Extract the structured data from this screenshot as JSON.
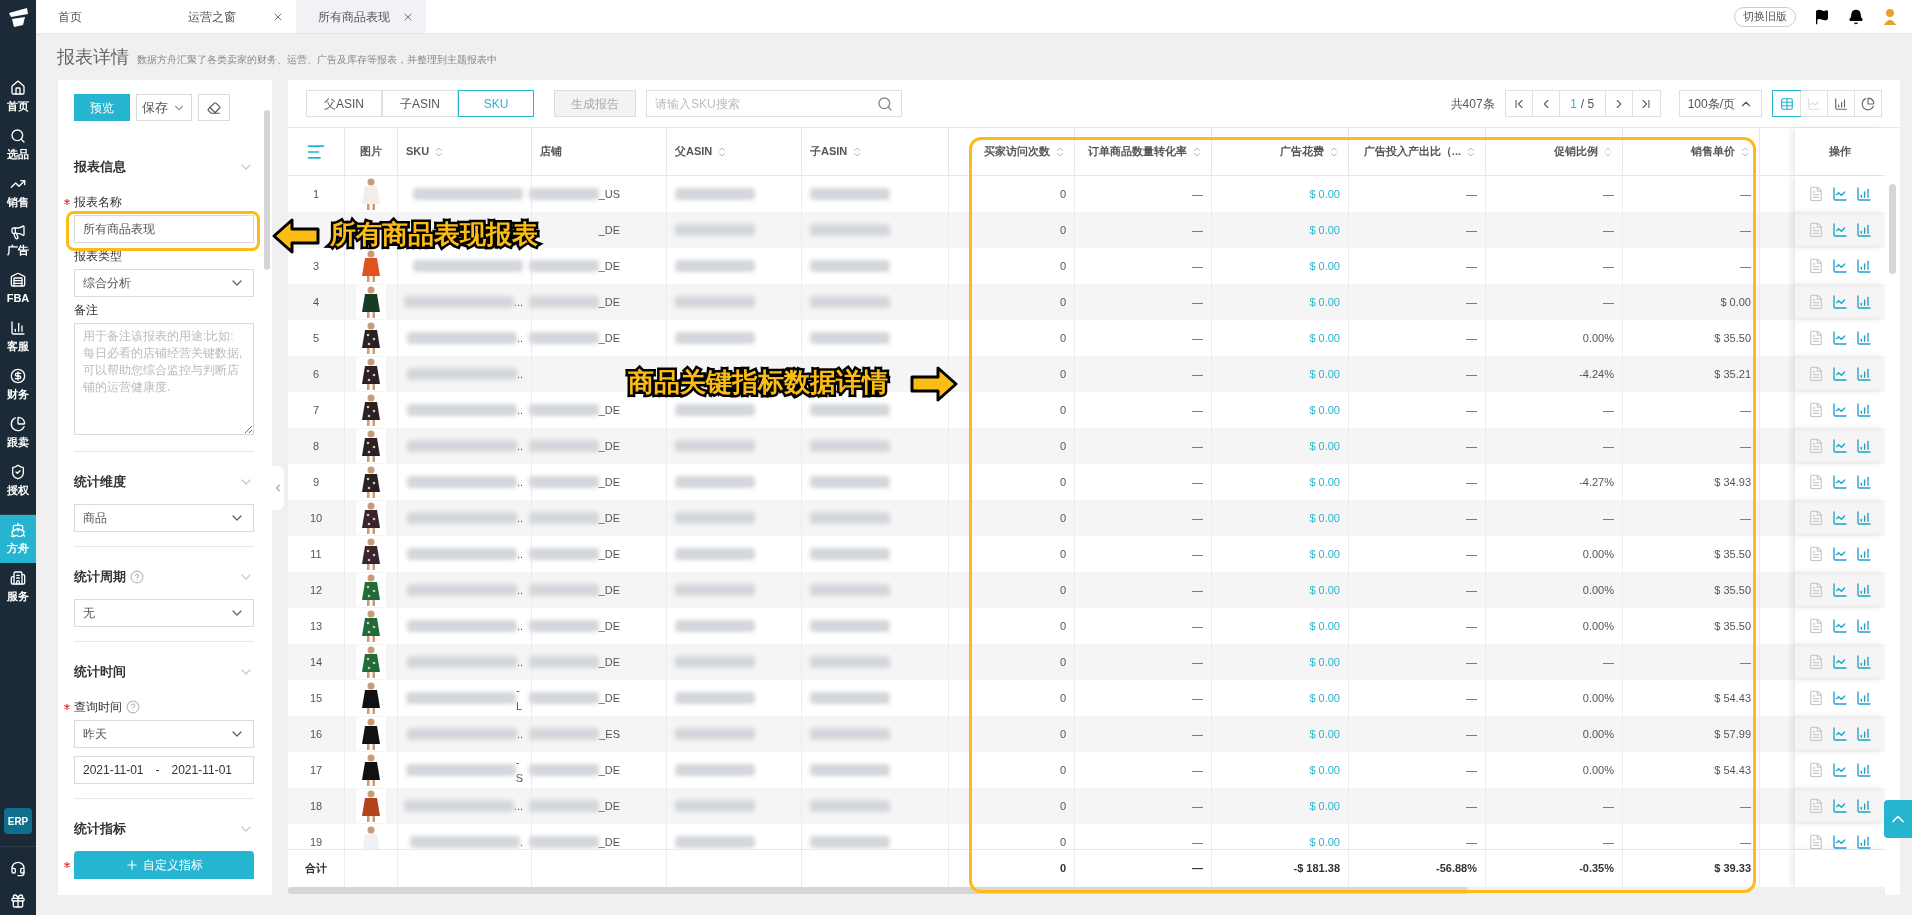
{
  "sidebar": {
    "items": [
      {
        "label": "首页",
        "selected": false
      },
      {
        "label": "选品",
        "selected": false
      },
      {
        "label": "销售",
        "selected": false
      },
      {
        "label": "广告",
        "selected": false
      },
      {
        "label": "FBA",
        "selected": false
      },
      {
        "label": "客服",
        "selected": false
      },
      {
        "label": "财务",
        "selected": false
      },
      {
        "label": "跟卖",
        "selected": false
      },
      {
        "label": "授权",
        "selected": false
      },
      {
        "label": "方舟",
        "selected": true
      },
      {
        "label": "服务",
        "selected": false
      }
    ],
    "badge": "ERP"
  },
  "tabs": [
    {
      "label": "首页",
      "selected": false,
      "closable": false
    },
    {
      "label": "运营之窗",
      "selected": false,
      "closable": true
    },
    {
      "label": "所有商品表现",
      "selected": true,
      "closable": true
    }
  ],
  "header": {
    "switch_button": "切换旧版"
  },
  "page": {
    "title": "报表详情",
    "subtitle": "数据方舟汇聚了各类卖家的财务、运营、广告及库存等报表，并整理到主题报表中"
  },
  "form": {
    "preview_button": "预览",
    "save_button": "保存",
    "sections": [
      {
        "title": "报表信息",
        "help": false,
        "fields": [
          {
            "kind": "input",
            "label": "报表名称",
            "required": true,
            "help": false,
            "value": "所有商品表现"
          },
          {
            "kind": "select",
            "label": "报表类型",
            "required": false,
            "help": false,
            "value": "综合分析"
          },
          {
            "kind": "textarea",
            "label": "备注",
            "required": false,
            "help": false,
            "placeholder": "用于备注该报表的用途:比如:每日必看的店铺经营关键数据,可以帮助您综合监控与判断店铺的运营健康度."
          }
        ]
      },
      {
        "title": "统计维度",
        "help": false,
        "fields": [
          {
            "kind": "select",
            "required": false,
            "help": false,
            "value": "商品"
          }
        ]
      },
      {
        "title": "统计周期",
        "help": true,
        "fields": [
          {
            "kind": "select",
            "required": false,
            "help": false,
            "value": "无"
          }
        ]
      },
      {
        "title": "统计时间",
        "help": false,
        "fields": [
          {
            "kind": "select",
            "label": "查询时间",
            "required": true,
            "help": true,
            "value": "昨天"
          },
          {
            "kind": "daterange",
            "required": false,
            "help": false,
            "start": "2021-11-01",
            "separator": "-",
            "end": "2021-11-01"
          }
        ]
      },
      {
        "title": "统计指标",
        "help": false,
        "fields": [
          {
            "kind": "button",
            "required": true,
            "help": false,
            "label": "自定义指标"
          }
        ]
      }
    ]
  },
  "toolbar": {
    "views": [
      {
        "label": "父ASIN",
        "selected": false
      },
      {
        "label": "子ASIN",
        "selected": false
      },
      {
        "label": "SKU",
        "selected": true
      }
    ],
    "generate_button": {
      "label": "生成报告",
      "disabled": true
    },
    "search": {
      "placeholder": "请输入SKU搜索"
    },
    "total": "共407条",
    "page": "1",
    "pages": "/ 5",
    "page_size": "100条/页",
    "chart_views": [
      {
        "kind": "table",
        "selected": true,
        "disabled": false
      },
      {
        "kind": "line",
        "selected": false,
        "disabled": true
      },
      {
        "kind": "bar",
        "selected": false,
        "disabled": false
      },
      {
        "kind": "pie",
        "selected": false,
        "disabled": false
      }
    ]
  },
  "table": {
    "columns": [
      {
        "label": "图片",
        "sortable": false
      },
      {
        "label": "SKU",
        "sortable": true
      },
      {
        "label": "店铺",
        "sortable": false
      },
      {
        "label": "父ASIN",
        "sortable": true
      },
      {
        "label": "子ASIN",
        "sortable": true
      },
      {
        "label": "买家访问次数",
        "sortable": true
      },
      {
        "label": "订单商品数量转化率",
        "sortable": true
      },
      {
        "label": "广告花费",
        "sortable": true
      },
      {
        "label": "广告投入产出比（...",
        "sortable": true
      },
      {
        "label": "促销比例",
        "sortable": true
      },
      {
        "label": "销售单价",
        "sortable": true
      }
    ],
    "actions_column": "操作",
    "rows": [
      {
        "index": "1",
        "store_tail": "_US",
        "visits": "0",
        "conversion": "—",
        "ad_spend": "$ 0.00",
        "roas": "—",
        "promo": "—",
        "price": "—"
      },
      {
        "store_tail": "_DE",
        "visits": "0",
        "conversion": "—",
        "ad_spend": "$ 0.00",
        "roas": "—",
        "promo": "—",
        "price": "—"
      },
      {
        "index": "3",
        "store_tail": "_DE",
        "visits": "0",
        "conversion": "—",
        "ad_spend": "$ 0.00",
        "roas": "—",
        "promo": "—",
        "price": "—"
      },
      {
        "index": "4",
        "sku_tail": "...",
        "store_tail": "_DE",
        "visits": "0",
        "conversion": "—",
        "ad_spend": "$ 0.00",
        "roas": "—",
        "promo": "—",
        "price": "$ 0.00"
      },
      {
        "index": "5",
        "sku_tail": "..",
        "store_tail": "_DE",
        "visits": "0",
        "conversion": "—",
        "ad_spend": "$ 0.00",
        "roas": "—",
        "promo": "0.00%",
        "price": "$ 35.50"
      },
      {
        "index": "6",
        "sku_tail": "..",
        "visits": "0",
        "conversion": "—",
        "ad_spend": "$ 0.00",
        "roas": "—",
        "promo": "-4.24%",
        "price": "$ 35.21"
      },
      {
        "index": "7",
        "sku_tail": "..",
        "store_tail": "_DE",
        "visits": "0",
        "conversion": "—",
        "ad_spend": "$ 0.00",
        "roas": "—",
        "promo": "—",
        "price": "—"
      },
      {
        "index": "8",
        "sku_tail": "..",
        "store_tail": "_DE",
        "visits": "0",
        "conversion": "—",
        "ad_spend": "$ 0.00",
        "roas": "—",
        "promo": "—",
        "price": "—"
      },
      {
        "index": "9",
        "sku_tail": "..",
        "store_tail": "_DE",
        "visits": "0",
        "conversion": "—",
        "ad_spend": "$ 0.00",
        "roas": "—",
        "promo": "-4.27%",
        "price": "$ 34.93"
      },
      {
        "index": "10",
        "sku_tail": "..",
        "store_tail": "_DE",
        "visits": "0",
        "conversion": "—",
        "ad_spend": "$ 0.00",
        "roas": "—",
        "promo": "—",
        "price": "—"
      },
      {
        "index": "11",
        "sku_tail": "..",
        "store_tail": "_DE",
        "visits": "0",
        "conversion": "—",
        "ad_spend": "$ 0.00",
        "roas": "—",
        "promo": "0.00%",
        "price": "$ 35.50"
      },
      {
        "index": "12",
        "sku_tail": "..",
        "store_tail": "_DE",
        "visits": "0",
        "conversion": "—",
        "ad_spend": "$ 0.00",
        "roas": "—",
        "promo": "0.00%",
        "price": "$ 35.50"
      },
      {
        "index": "13",
        "sku_tail": "..",
        "store_tail": "_DE",
        "visits": "0",
        "conversion": "—",
        "ad_spend": "$ 0.00",
        "roas": "—",
        "promo": "0.00%",
        "price": "$ 35.50"
      },
      {
        "index": "14",
        "sku_tail": "..",
        "store_tail": "_DE",
        "visits": "0",
        "conversion": "—",
        "ad_spend": "$ 0.00",
        "roas": "—",
        "promo": "—",
        "price": "—"
      },
      {
        "index": "15",
        "sku_tail": "-L",
        "store_tail": "_DE",
        "visits": "0",
        "conversion": "—",
        "ad_spend": "$ 0.00",
        "roas": "—",
        "promo": "0.00%",
        "price": "$ 54.43"
      },
      {
        "index": "16",
        "sku_tail": "..",
        "store_tail": "_ES",
        "visits": "0",
        "conversion": "—",
        "ad_spend": "$ 0.00",
        "roas": "—",
        "promo": "0.00%",
        "price": "$ 57.99"
      },
      {
        "index": "17",
        "sku_tail": "-S",
        "store_tail": "_DE",
        "visits": "0",
        "conversion": "—",
        "ad_spend": "$ 0.00",
        "roas": "—",
        "promo": "0.00%",
        "price": "$ 54.43"
      },
      {
        "index": "18",
        "sku_tail": "...",
        "store_tail": "_DE",
        "visits": "0",
        "conversion": "—",
        "ad_spend": "$ 0.00",
        "roas": "—",
        "promo": "—",
        "price": "—"
      },
      {
        "index": "19",
        "sku_tail": ".",
        "store_tail": "_DE",
        "visits": "0",
        "conversion": "—",
        "ad_spend": "$ 0.00",
        "roas": "—",
        "promo": "—",
        "price": "—"
      }
    ],
    "totals": {
      "label": "合计",
      "visits": "0",
      "conversion": "—",
      "ad_spend": "-$ 181.38",
      "roas": "-56.88%",
      "promo": "-0.35%",
      "price": "$ 39.33"
    }
  },
  "annotations": [
    {
      "text": "所有商品表现报表",
      "pointing_left": true
    },
    {
      "text": "商品关键指标数据详情",
      "pointing_left": false
    }
  ]
}
